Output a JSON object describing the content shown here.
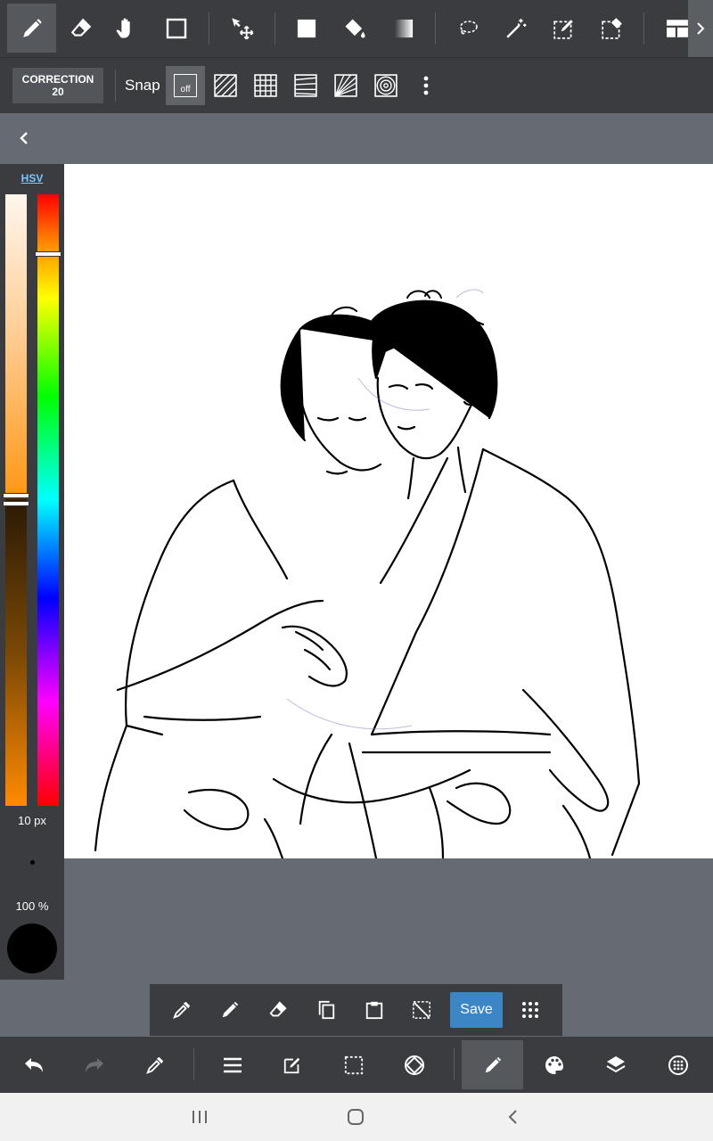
{
  "toolbar": {
    "tools": [
      "pen-tool",
      "eraser-tool",
      "hand-tool",
      "rectangle-select-tool",
      "move-tool",
      "fill-rect-tool",
      "bucket-tool",
      "gradient-tool",
      "lasso-tool",
      "magic-wand-tool",
      "select-pen-tool",
      "select-eraser-tool",
      "layout-tool"
    ],
    "selected": "pen-tool"
  },
  "subbar": {
    "correction_label": "CORRECTION",
    "correction_value": "20",
    "snap_label": "Snap",
    "snap_off_label": "off"
  },
  "color_panel": {
    "mode_label": "HSV",
    "brush_size": "10 px",
    "opacity": "100 %",
    "current_color": "#000000"
  },
  "float_toolbar": {
    "save_label": "Save"
  },
  "colors": {
    "bar_bg": "#3a3c40",
    "workspace_bg": "#666a72",
    "accent": "#3d86c6",
    "hsv_link": "#7cc7ff"
  }
}
